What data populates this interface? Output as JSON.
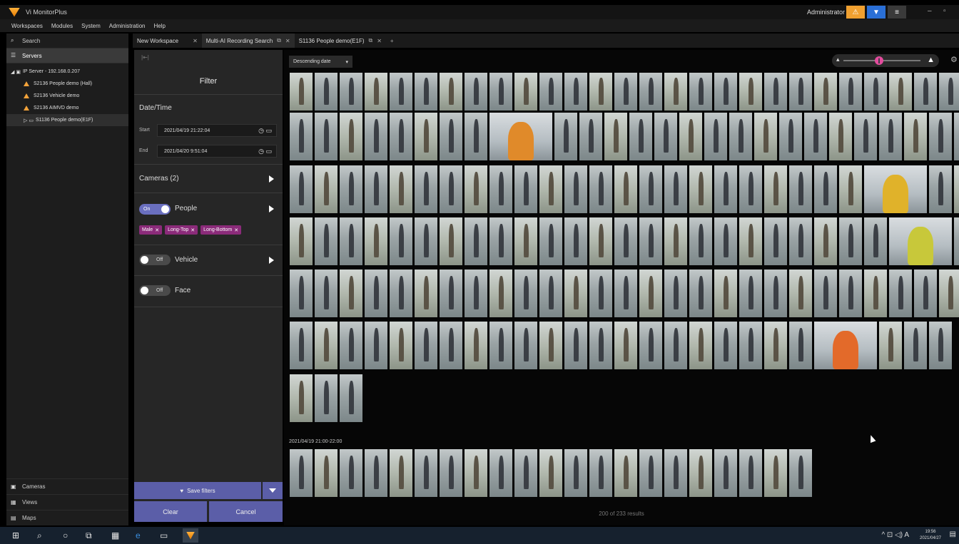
{
  "app": {
    "title": "Vi MonitorPlus",
    "user": "Administrator"
  },
  "menu": [
    "Workspaces",
    "Modules",
    "System",
    "Administration",
    "Help"
  ],
  "left_pane": {
    "search": "Search",
    "servers": "Servers",
    "tree": [
      {
        "label": "IP Server - 192.168.0.207",
        "warn": false,
        "indent": 0,
        "prefix": "◢ ▣"
      },
      {
        "label": "S2136 People demo (Hall)",
        "warn": true,
        "indent": 1
      },
      {
        "label": "S2136 Vehicle demo",
        "warn": true,
        "indent": 1
      },
      {
        "label": "S2136 AIMVD demo",
        "warn": true,
        "indent": 1
      },
      {
        "label": "S1136 People demo(E1F)",
        "warn": false,
        "indent": 1,
        "prefix": "▷ ▭",
        "selected": true
      }
    ],
    "bottom": [
      "Cameras",
      "Views",
      "Maps"
    ]
  },
  "tabs": [
    {
      "label": "New Workspace",
      "active": false
    },
    {
      "label": "Multi-AI Recording Search",
      "active": true
    },
    {
      "label": "S1136 People demo(E1F)",
      "active": false
    }
  ],
  "filter": {
    "title": "Filter",
    "datetime_label": "Date/Time",
    "start_label": "Start",
    "start_value": "2021/04/19   21:22:04",
    "end_label": "End",
    "end_value": "2021/04/20   9:51:04",
    "cameras_label": "Cameras (2)",
    "people": {
      "label": "People",
      "toggle": "On"
    },
    "people_tags": [
      "Male",
      "Long-Top",
      "Long-Bottom"
    ],
    "vehicle": {
      "label": "Vehicle",
      "toggle": "Off"
    },
    "face": {
      "label": "Face",
      "toggle": "Off"
    },
    "save_label": "Save filters",
    "clear_label": "Clear",
    "cancel_label": "Cancel"
  },
  "results": {
    "sort": "Descending date",
    "rows": [
      {
        "wide": [],
        "count": 28
      },
      {
        "wide": [
          8
        ],
        "wide_style": "orange",
        "count": 27
      },
      {
        "wide": [
          23
        ],
        "wide_style": "yel",
        "count": 26
      },
      {
        "wide": [
          24
        ],
        "wide_style": "lime",
        "count": 26
      },
      {
        "wide": [],
        "count": 28
      },
      {
        "wide": [
          21
        ],
        "wide_style": "red",
        "count": 25
      },
      {
        "wide": [],
        "count": 3
      }
    ],
    "group_label": "2021/04/19 21:00-22:00",
    "group_count": 21,
    "count_text": "200 of 233 results"
  },
  "taskbar": {
    "time": "19:56",
    "date": "2021/04/27"
  }
}
